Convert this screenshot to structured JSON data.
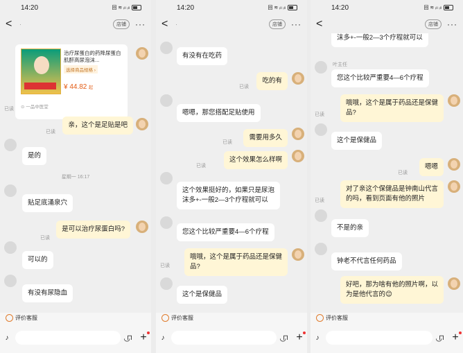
{
  "statusbar": {
    "time": "14:20",
    "icons": "回 ≋ ᵢₗₗ ᵢₗₗ"
  },
  "header": {
    "back": "<",
    "store": "店铺",
    "more": "···"
  },
  "panel1": {
    "title": "·",
    "product": {
      "title": "治疗尿蛋白的药降尿蛋白肌酐高尿泡沫...",
      "tag": "选择商品规格 ›",
      "price": "¥ 44.82",
      "price_unit": "起",
      "shop": "一品中医堂"
    },
    "read_labels": [
      "已读",
      "已读",
      "已读"
    ],
    "bubble1": "亲，这个是足贴是吧",
    "bubble2": "是的",
    "time1": "星期一 16:17",
    "bubble3": "贴足底涌泉穴",
    "bubble4": "是可以治疗尿蛋白吗?",
    "bubble5": "可以的",
    "bubble6": "有没有尿隐血"
  },
  "panel2": {
    "title": "·",
    "bubble1": "有没有在吃药",
    "bubble2": "吃的有",
    "bubble3": "嗯嗯，那您搭配足贴使用",
    "bubble4": "需要用多久",
    "bubble5": "这个效果怎么样啊",
    "bubble6": "这个效果挺好的，如果只是尿泡\n沫多+-一般2—3个疗程就可以",
    "bubble7": "您这个比较严重要4—6个疗程",
    "bubble8": "哦哦，这个是属于药品还是保健\n品?",
    "bubble9": "这个是保健品",
    "read_labels": [
      "已读",
      "已读",
      "已读",
      "已读"
    ]
  },
  "panel3": {
    "bubble0": "沫多+-一般2—3个疗程就可以",
    "name_label": "叶主任",
    "bubble1": "您这个比较严重要4—6个疗程",
    "bubble2": "哦哦，这个是属于药品还是保健\n品?",
    "bubble3": "这个是保健品",
    "bubble4": "嗯嗯",
    "bubble5": "对了亲这个保健品是钟南山代言\n的吗，看到页面有他的照片",
    "bubble6": "不是的亲",
    "bubble7": "钟老不代言任何药品",
    "bubble8": "好吧，那为啥有他的照片啊，以\n为是他代言的😊",
    "read_labels": [
      "已读",
      "已读",
      "已读"
    ]
  },
  "bottom": {
    "eval_label": "评价客服",
    "mic": "♪",
    "smile": "◡",
    "bag": "⊓",
    "plus": "+"
  }
}
